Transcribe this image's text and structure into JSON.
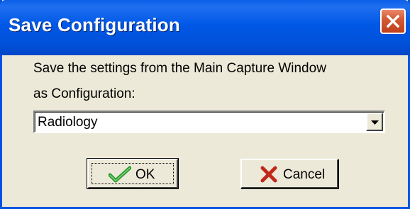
{
  "window": {
    "title": "Save Configuration"
  },
  "prompt": {
    "line1": "Save the settings from the Main Capture Window",
    "line2": "as Configuration:"
  },
  "config_select": {
    "value": "Radiology"
  },
  "buttons": {
    "ok_label": "OK",
    "cancel_label": "Cancel"
  },
  "icons": {
    "close": "close-icon",
    "dropdown": "chevron-down-icon",
    "ok": "checkmark-icon",
    "cancel": "x-mark-icon"
  },
  "colors": {
    "titlebar": "#0058e6",
    "close_button": "#d35a34",
    "dialog_face": "#ece9d8",
    "ok_check": "#2a9a2a",
    "cancel_x": "#c02818"
  }
}
